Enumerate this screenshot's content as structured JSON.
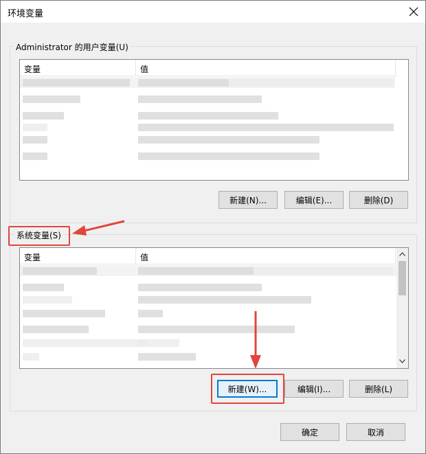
{
  "window": {
    "title": "环境变量"
  },
  "user_vars": {
    "group_label": "Administrator 的用户变量(U)",
    "col_variable": "变量",
    "col_value": "值",
    "buttons": {
      "new": "新建(N)...",
      "edit": "编辑(E)...",
      "delete": "删除(D)"
    }
  },
  "system_vars": {
    "group_label": "系统变量(S)",
    "col_variable": "变量",
    "col_value": "值",
    "buttons": {
      "new": "新建(W)...",
      "edit": "编辑(I)...",
      "delete": "删除(L)"
    }
  },
  "footer": {
    "ok": "确定",
    "cancel": "取消"
  },
  "annotations": {
    "highlight_color": "#e0463a"
  },
  "icons": {
    "close": "close-icon",
    "scroll_up": "chevron-up-icon",
    "scroll_down": "chevron-down-icon"
  }
}
